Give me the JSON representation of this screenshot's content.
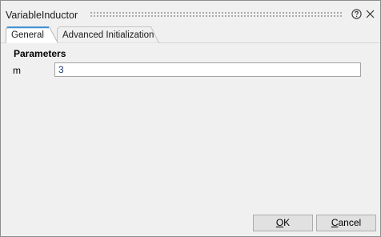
{
  "window": {
    "title": "VariableInductor"
  },
  "titlebar_icons": {
    "help": "help-circle-icon",
    "close": "close-icon"
  },
  "tabs": [
    {
      "label": "General",
      "selected": true
    },
    {
      "label": "Advanced Initialization",
      "selected": false
    }
  ],
  "parameters": {
    "header": "Parameters",
    "fields": [
      {
        "label": "m",
        "value": "3"
      }
    ]
  },
  "buttons": {
    "ok": {
      "mnemonic": "O",
      "rest": "K"
    },
    "cancel": {
      "mnemonic": "C",
      "rest": "ancel"
    }
  },
  "colors": {
    "window_bg": "#f0f0f0",
    "selected_tab_accent": "#3a8fd6",
    "input_text": "#1f3a78"
  }
}
